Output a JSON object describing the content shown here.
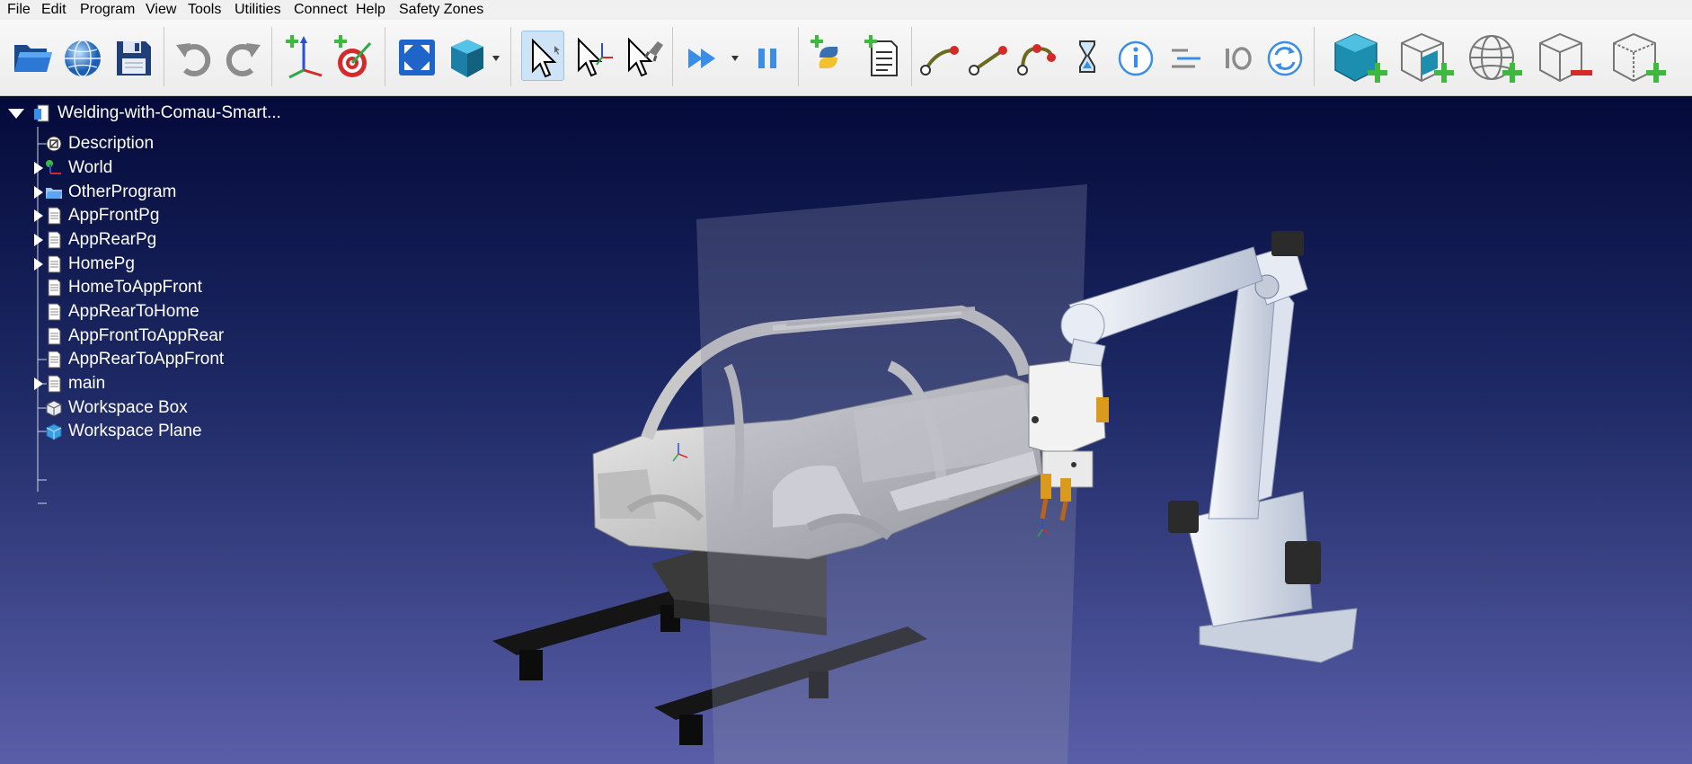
{
  "menu": [
    "File",
    "Edit",
    "Program",
    "View",
    "Tools",
    "Utilities",
    "Connect",
    "Help",
    "Safety Zones"
  ],
  "toolbar": {
    "buttons": [
      {
        "name": "open-file",
        "icon": "folder-open-icon"
      },
      {
        "name": "open-online-library",
        "icon": "globe-icon"
      },
      {
        "name": "save",
        "icon": "floppy-disk-icon"
      },
      {
        "name": "undo",
        "icon": "undo-icon"
      },
      {
        "name": "redo",
        "icon": "redo-icon"
      },
      {
        "name": "add-reference-frame",
        "icon": "add-frame-icon"
      },
      {
        "name": "add-target",
        "icon": "add-target-icon"
      },
      {
        "name": "fit-all",
        "icon": "fit-view-icon"
      },
      {
        "name": "view-iso",
        "icon": "cube-view-icon"
      },
      {
        "name": "select",
        "icon": "cursor-icon",
        "active": true
      },
      {
        "name": "select-move-frame",
        "icon": "cursor-frame-icon"
      },
      {
        "name": "select-move-tool",
        "icon": "cursor-tool-icon"
      },
      {
        "name": "run-program",
        "icon": "fast-forward-icon"
      },
      {
        "name": "pause",
        "icon": "pause-icon"
      },
      {
        "name": "add-python-program",
        "icon": "python-icon"
      },
      {
        "name": "add-program",
        "icon": "add-program-icon"
      },
      {
        "name": "move-joint",
        "icon": "move-joint-icon"
      },
      {
        "name": "move-linear",
        "icon": "move-linear-icon"
      },
      {
        "name": "move-circular",
        "icon": "move-circular-icon"
      },
      {
        "name": "pause-instruction",
        "icon": "hourglass-icon"
      },
      {
        "name": "show-message",
        "icon": "info-icon"
      },
      {
        "name": "program-call",
        "icon": "program-call-icon"
      },
      {
        "name": "set-io",
        "icon": "io-icon"
      },
      {
        "name": "reload",
        "icon": "refresh-icon"
      },
      {
        "name": "add-workspace-box",
        "icon": "add-box-icon"
      },
      {
        "name": "add-workspace-plane",
        "icon": "add-plane-icon"
      },
      {
        "name": "add-workspace-sphere",
        "icon": "add-sphere-icon"
      },
      {
        "name": "remove-workspace",
        "icon": "remove-box-icon"
      },
      {
        "name": "add-workspace-other",
        "icon": "add-wire-box-icon"
      }
    ]
  },
  "tree": {
    "root": "Welding-with-Comau-Smart...",
    "items": [
      {
        "label": "Description",
        "icon": "description-icon",
        "expandable": false
      },
      {
        "label": "World",
        "icon": "world-frame-icon",
        "expandable": true
      },
      {
        "label": "OtherProgram",
        "icon": "folder-icon",
        "expandable": true
      },
      {
        "label": "AppFrontPg",
        "icon": "program-icon",
        "expandable": true
      },
      {
        "label": "AppRearPg",
        "icon": "program-icon",
        "expandable": true
      },
      {
        "label": "HomePg",
        "icon": "program-icon",
        "expandable": true
      },
      {
        "label": "HomeToAppFront",
        "icon": "program-icon",
        "expandable": false
      },
      {
        "label": "AppRearToHome",
        "icon": "program-icon",
        "expandable": false
      },
      {
        "label": "AppFrontToAppRear",
        "icon": "program-icon",
        "expandable": false
      },
      {
        "label": "AppRearToAppFront",
        "icon": "program-icon",
        "expandable": false
      },
      {
        "label": "main",
        "icon": "program-icon",
        "expandable": true
      },
      {
        "label": "Workspace Box",
        "icon": "box-icon",
        "expandable": false
      },
      {
        "label": "Workspace Plane",
        "icon": "plane-icon",
        "expandable": false
      }
    ]
  },
  "colors": {
    "viewport_top": "#040a3a",
    "viewport_bottom": "#5a5ea8",
    "robot": "#e2e8f2",
    "car_body": "#d2d2d2",
    "rails": "#151515",
    "active_button": "#cfe3f7",
    "accent_green": "#3fb83f"
  }
}
